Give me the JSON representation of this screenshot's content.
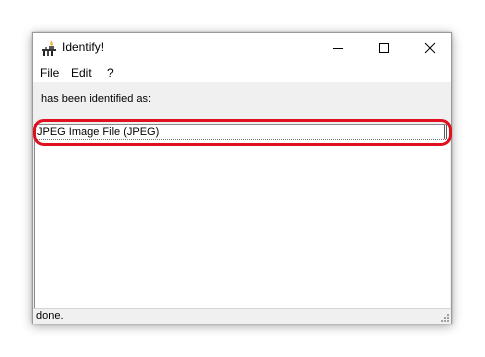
{
  "window": {
    "title": "Identify!",
    "icon": "identify-app-icon",
    "controls": {
      "minimize": "minimize-icon",
      "maximize": "maximize-icon",
      "close": "close-icon"
    }
  },
  "menu": {
    "file": "File",
    "edit": "Edit",
    "help": "?"
  },
  "message": "has been identified as:",
  "result": {
    "items": [
      "JPEG Image File (JPEG)"
    ],
    "highlight_color": "#e01020"
  },
  "status": "done."
}
